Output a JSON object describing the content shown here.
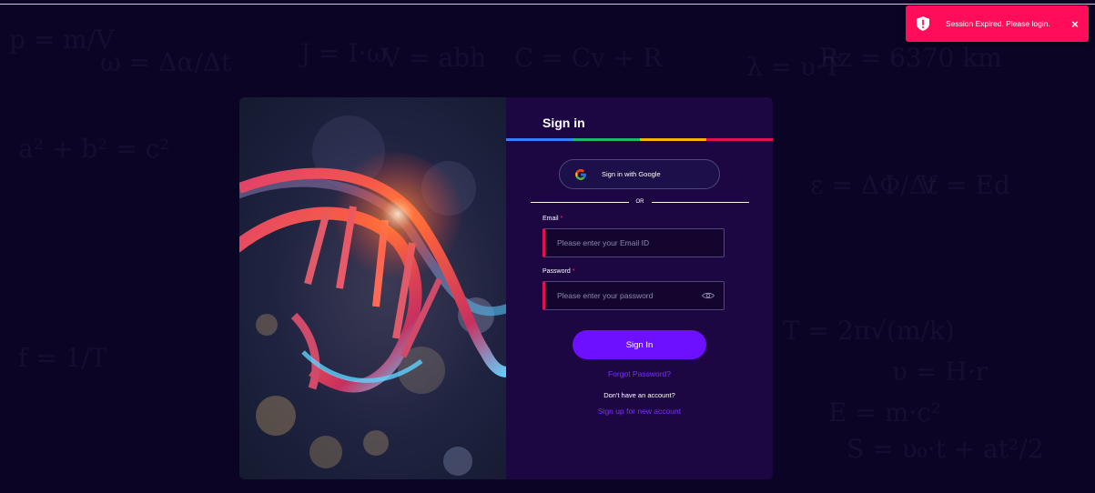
{
  "background": {
    "formulas": [
      "ω = Δα/Δt",
      "J = I·ω",
      "V = abh",
      "λ = υ·T",
      "Rz = 6370 km",
      "C = Cv + R",
      "p = m/V",
      "E = m·c²",
      "V = Ed",
      "S = υ₀·t + at²/2",
      "T = 2π√(m/k)",
      "f = 1/T",
      "υ = H·r",
      "a² + b² = c²",
      "ε = ΔΦ/Δt"
    ],
    "color": "#0c0424"
  },
  "toast": {
    "message": "Session Expired. Please login.",
    "close_label": "×",
    "icon": "shield-alert-icon",
    "color": "#ff0d5a"
  },
  "login": {
    "title": "Sign in",
    "accent_colors": [
      "#3d7bff",
      "#21b66a",
      "#f4b400",
      "#e4114f"
    ],
    "google_button_label": "Sign in with Google",
    "divider_text": "OR",
    "email_label": "Email",
    "email_placeholder": "Please enter your Email ID",
    "password_label": "Password",
    "password_placeholder": "Please enter your password",
    "required_mark": "*",
    "sign_in_button": "Sign In",
    "forgot_password": "Forgot Password?",
    "no_account_text": "Don't have an account?",
    "sign_up_link": "Sign up for new account"
  },
  "hero_image": {
    "subject": "dna-double-helix-illustration"
  }
}
